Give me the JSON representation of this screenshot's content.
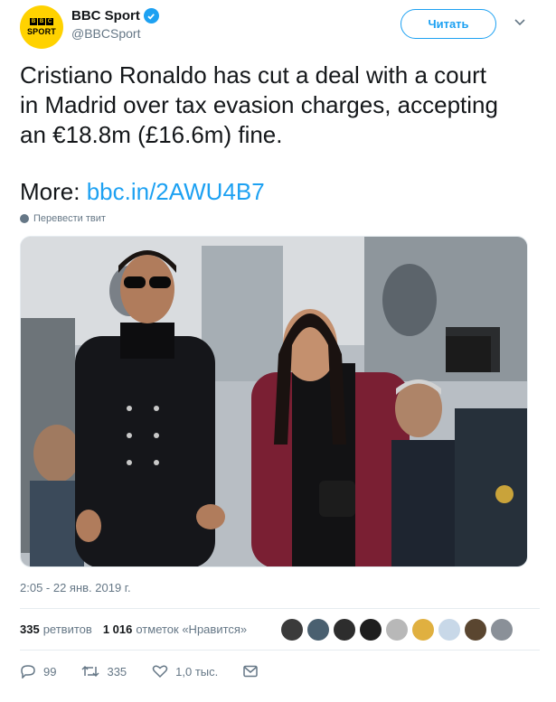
{
  "account": {
    "display_name": "BBC Sport",
    "handle": "@BBCSport",
    "logo_blocks": [
      "B",
      "B",
      "C"
    ],
    "logo_word": "SPORT",
    "follow_label": "Читать"
  },
  "tweet": {
    "text_lines": [
      "Cristiano Ronaldo has cut a deal with a court",
      "in Madrid over tax evasion charges, accepting",
      "an €18.8m (£16.6m) fine."
    ],
    "more_prefix": "More: ",
    "link_text": "bbc.in/2AWU4B7",
    "translate_label": "Перевести твит",
    "timestamp": "2:05 - 22 янв. 2019 г."
  },
  "stats": {
    "retweets_count": "335",
    "retweets_label": "ретвитов",
    "likes_count": "1 016",
    "likes_label": "отметок «Нравится»",
    "liker_colors": [
      "#3b3b3b",
      "#4a6070",
      "#2d2d2d",
      "#1e1e1e",
      "#b8b8b8",
      "#e0b040",
      "#c8d8e8",
      "#5a4630",
      "#8a9098"
    ]
  },
  "actions": {
    "replies": "99",
    "retweets": "335",
    "likes": "1,0 тыс."
  },
  "colors": {
    "accent": "#1da1f2",
    "secondary_text": "#657786",
    "brand_yellow": "#ffd200"
  }
}
